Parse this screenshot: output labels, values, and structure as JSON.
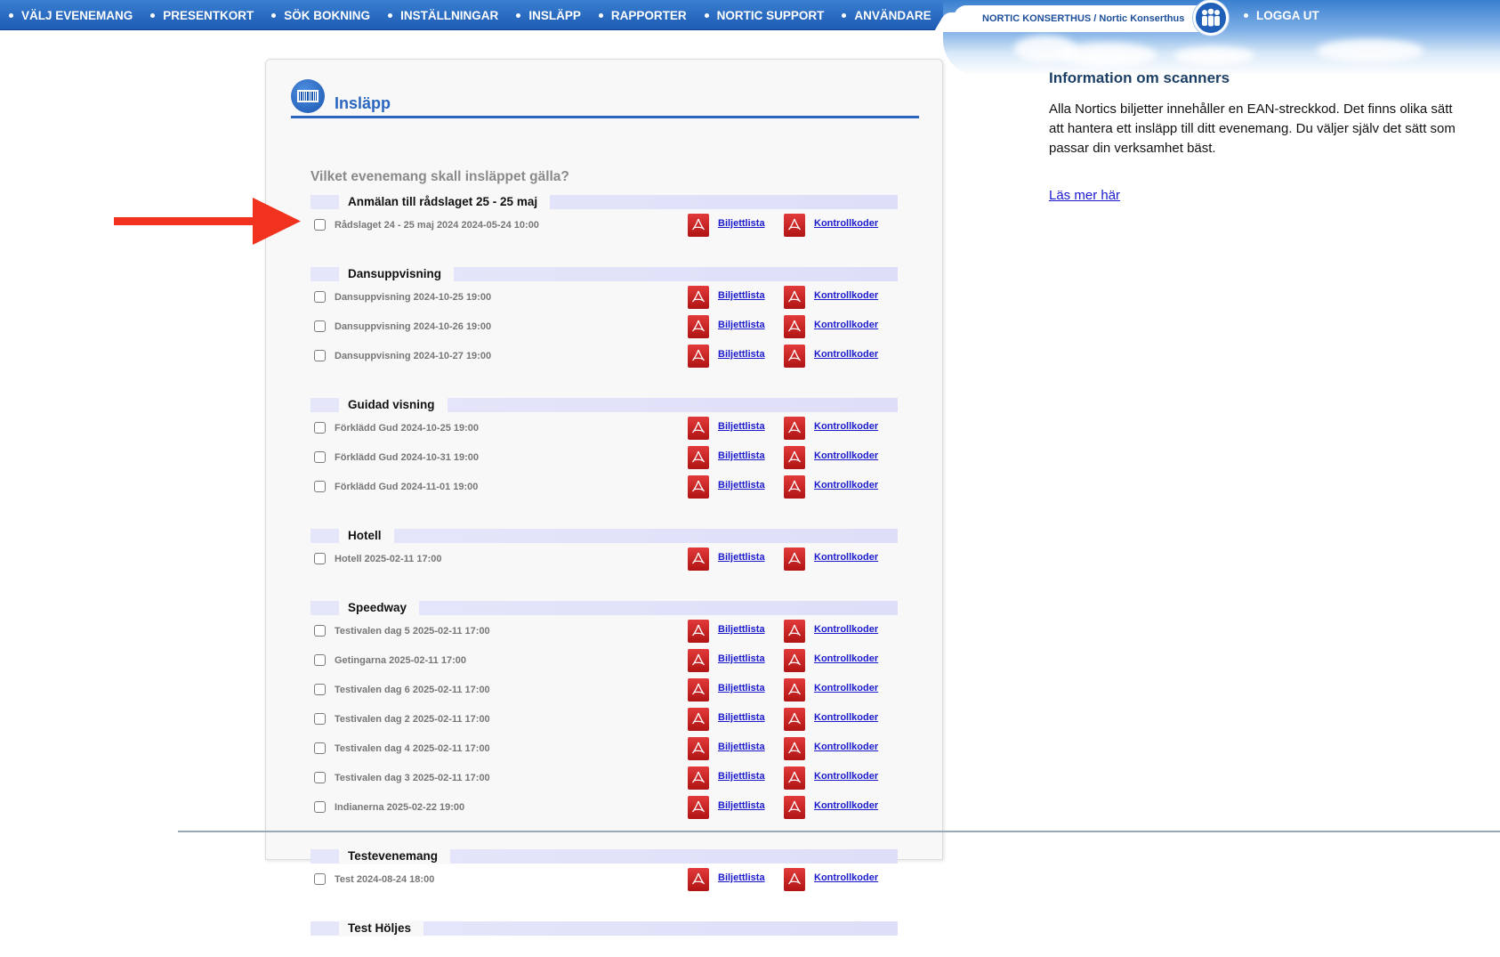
{
  "nav": {
    "items": [
      {
        "label": "VÄLJ EVENEMANG"
      },
      {
        "label": "PRESENTKORT"
      },
      {
        "label": "SÖK BOKNING"
      },
      {
        "label": "INSTÄLLNINGAR"
      },
      {
        "label": "INSLÄPP"
      },
      {
        "label": "RAPPORTER"
      },
      {
        "label": "NORTIC SUPPORT"
      },
      {
        "label": "ANVÄNDARE"
      }
    ],
    "account": "NORTIC KONSERTHUS / Nortic Konserthus",
    "logout": "LOGGA UT"
  },
  "panel": {
    "title": "Insläpp",
    "question": "Vilket evenemang skall insläppet gälla?",
    "ticket_list_label": "Biljettlista",
    "control_codes_label": "Kontrollkoder",
    "groups": [
      {
        "title": "Anmälan till rådslaget 25 - 25 maj",
        "events": [
          "Rådslaget 24 - 25 maj 2024 2024-05-24 10:00"
        ]
      },
      {
        "title": "Dansuppvisning",
        "events": [
          "Dansuppvisning 2024-10-25 19:00",
          "Dansuppvisning 2024-10-26 19:00",
          "Dansuppvisning 2024-10-27 19:00"
        ]
      },
      {
        "title": "Guidad visning",
        "events": [
          "Förklädd Gud 2024-10-25 19:00",
          "Förklädd Gud 2024-10-31 19:00",
          "Förklädd Gud 2024-11-01 19:00"
        ]
      },
      {
        "title": "Hotell",
        "events": [
          "Hotell 2025-02-11 17:00"
        ]
      },
      {
        "title": "Speedway",
        "events": [
          "Testivalen dag 5 2025-02-11 17:00",
          "Getingarna 2025-02-11 17:00",
          "Testivalen dag 6 2025-02-11 17:00",
          "Testivalen dag 2 2025-02-11 17:00",
          "Testivalen dag 4 2025-02-11 17:00",
          "Testivalen dag 3 2025-02-11 17:00",
          "Indianerna 2025-02-22 19:00"
        ]
      },
      {
        "title": "Testevenemang",
        "events": [
          "Test 2024-08-24 18:00"
        ]
      },
      {
        "title": "Test Höljes",
        "events": []
      }
    ]
  },
  "info": {
    "title": "Information om scanners",
    "text": "Alla Nortics biljetter innehåller en EAN-streckkod. Det finns olika sätt att hantera ett insläpp till ditt evenemang. Du väljer själv det sätt som passar din verksamhet bäst.",
    "link": "Läs mer här"
  },
  "colors": {
    "nav_blue": "#1d5cb4",
    "accent_blue": "#2a66c0",
    "pdf_red": "#c41e1e",
    "arrow_red": "#f0321e"
  },
  "icons": {
    "panel": "barcode-icon",
    "account": "people-icon",
    "document": "pdf-icon",
    "annotation": "red-arrow"
  }
}
